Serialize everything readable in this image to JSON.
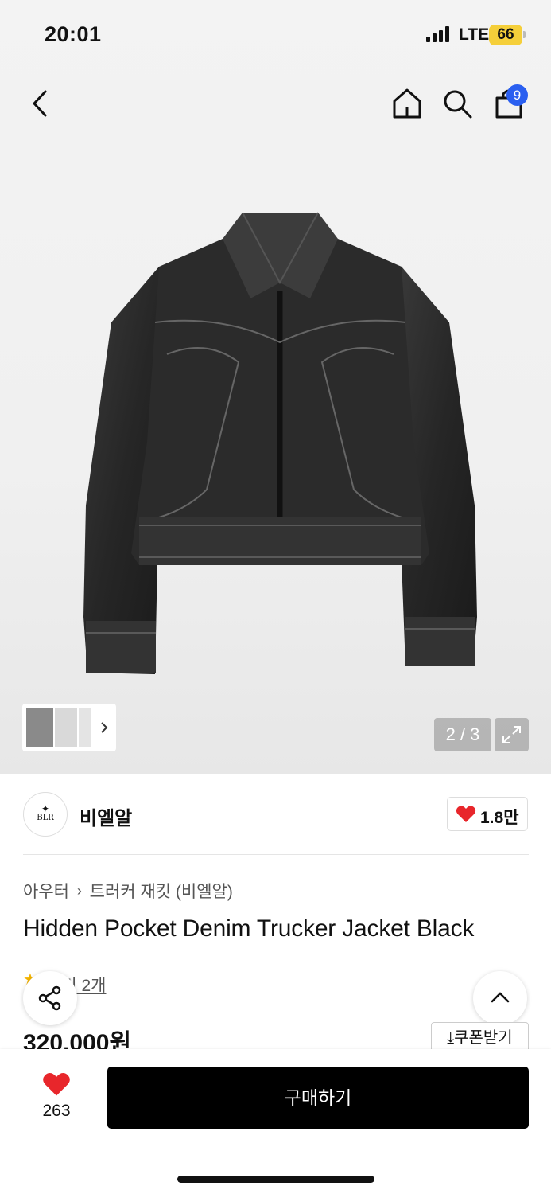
{
  "status_bar": {
    "time": "20:01",
    "network": "LTE",
    "battery": "66"
  },
  "header": {
    "cart_count": "9"
  },
  "gallery": {
    "counter": "2 / 3",
    "current": 2,
    "total": 3
  },
  "brand": {
    "logo_text": "BLR",
    "name": "비엘알",
    "likes": "1.8만"
  },
  "product": {
    "category": "아우터",
    "subcategory": "트러커 재킷 (비엘알)",
    "title": "Hidden Pocket Denim Trucker Jacket Black",
    "review_text": "후기 2개",
    "price": "320,000원",
    "coupon_label": "쿠폰받기"
  },
  "bottom": {
    "wish_count": "263",
    "buy_label": "구매하기"
  },
  "colors": {
    "accent_blue": "#2a5ff0",
    "heart_red": "#e8262b",
    "battery_yellow": "#f5cf3a"
  }
}
